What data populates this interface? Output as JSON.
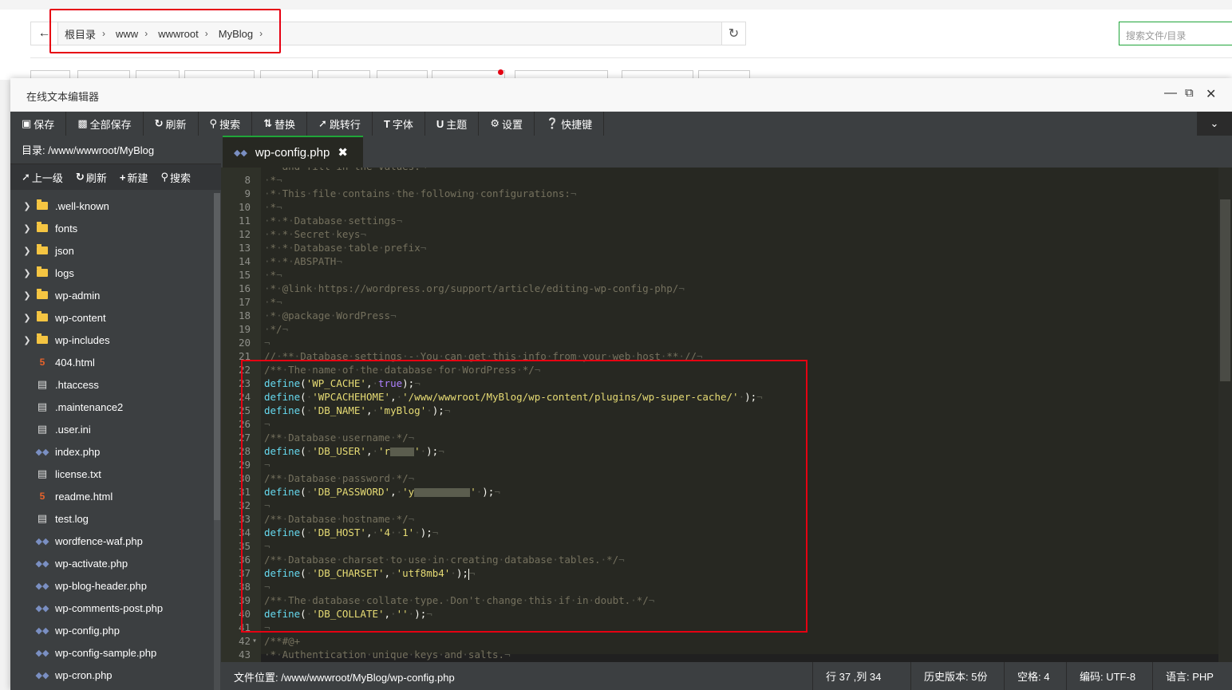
{
  "file_manager": {
    "breadcrumb": [
      "根目录",
      "www",
      "wwwroot",
      "MyBlog"
    ],
    "search_placeholder": "搜索文件/目录"
  },
  "editor": {
    "title": "在线文本编辑器",
    "toolbar": [
      {
        "icon": "save-icon",
        "label": "保存"
      },
      {
        "icon": "save-all-icon",
        "label": "全部保存"
      },
      {
        "icon": "refresh-icon",
        "label": "刷新"
      },
      {
        "icon": "search-icon",
        "label": "搜索"
      },
      {
        "icon": "replace-icon",
        "label": "替换"
      },
      {
        "icon": "pin-icon",
        "label": "跳转行"
      },
      {
        "icon": "font-icon",
        "label": "字体"
      },
      {
        "icon": "theme-icon",
        "label": "主题"
      },
      {
        "icon": "gear-icon",
        "label": "设置"
      },
      {
        "icon": "help-icon",
        "label": "快捷键"
      }
    ],
    "sidebar": {
      "dir_label": "目录: /www/wwwroot/MyBlog",
      "tools": {
        "up": "上一级",
        "refresh": "刷新",
        "new": "新建",
        "search": "搜索"
      },
      "files": [
        {
          "name": ".well-known",
          "type": "folder"
        },
        {
          "name": "fonts",
          "type": "folder"
        },
        {
          "name": "json",
          "type": "folder"
        },
        {
          "name": "logs",
          "type": "folder"
        },
        {
          "name": "wp-admin",
          "type": "folder"
        },
        {
          "name": "wp-content",
          "type": "folder"
        },
        {
          "name": "wp-includes",
          "type": "folder"
        },
        {
          "name": "404.html",
          "type": "html"
        },
        {
          "name": ".htaccess",
          "type": "text"
        },
        {
          "name": ".maintenance2",
          "type": "text"
        },
        {
          "name": ".user.ini",
          "type": "text"
        },
        {
          "name": "index.php",
          "type": "php"
        },
        {
          "name": "license.txt",
          "type": "text"
        },
        {
          "name": "readme.html",
          "type": "html"
        },
        {
          "name": "test.log",
          "type": "text"
        },
        {
          "name": "wordfence-waf.php",
          "type": "php"
        },
        {
          "name": "wp-activate.php",
          "type": "php"
        },
        {
          "name": "wp-blog-header.php",
          "type": "php"
        },
        {
          "name": "wp-comments-post.php",
          "type": "php"
        },
        {
          "name": "wp-config.php",
          "type": "php"
        },
        {
          "name": "wp-config-sample.php",
          "type": "php"
        },
        {
          "name": "wp-cron.php",
          "type": "php"
        }
      ]
    },
    "tab": {
      "filename": "wp-config.php"
    },
    "status": {
      "file_path": "文件位置: /www/wwwroot/MyBlog/wp-config.php",
      "cursor": "行 37 ,列 34",
      "history": "历史版本: 5份",
      "indent": "空格: 4",
      "encoding": "编码: UTF-8",
      "language": "语言: PHP"
    },
    "code_lines": [
      {
        "n": "",
        "text": " * and fill in the values."
      },
      {
        "n": "8",
        "text": " *"
      },
      {
        "n": "9",
        "text": " * This file contains the following configurations:"
      },
      {
        "n": "10",
        "text": " *"
      },
      {
        "n": "11",
        "text": " * * Database settings"
      },
      {
        "n": "12",
        "text": " * * Secret keys"
      },
      {
        "n": "13",
        "text": " * * Database table prefix"
      },
      {
        "n": "14",
        "text": " * * ABSPATH"
      },
      {
        "n": "15",
        "text": " *"
      },
      {
        "n": "16",
        "text": " * @link https://wordpress.org/support/article/editing-wp-config-php/"
      },
      {
        "n": "17",
        "text": " *"
      },
      {
        "n": "18",
        "text": " * @package WordPress"
      },
      {
        "n": "19",
        "text": " */"
      },
      {
        "n": "20",
        "text": ""
      },
      {
        "n": "21",
        "text": "// ** Database settings - You can get this info from your web host ** //"
      },
      {
        "n": "22",
        "text": "/** The name of the database for WordPress */"
      },
      {
        "n": "23",
        "text": "define('WP_CACHE', true);"
      },
      {
        "n": "24",
        "text": "define( 'WPCACHEHOME', '/www/wwwroot/MyBlog/wp-content/plugins/wp-super-cache/' );"
      },
      {
        "n": "25",
        "text": "define( 'DB_NAME', 'myBlog' );"
      },
      {
        "n": "26",
        "text": ""
      },
      {
        "n": "27",
        "text": "/** Database username */"
      },
      {
        "n": "28",
        "text": "define( 'DB_USER', 'r' );"
      },
      {
        "n": "29",
        "text": ""
      },
      {
        "n": "30",
        "text": "/** Database password */"
      },
      {
        "n": "31",
        "text": "define( 'DB_PASSWORD', 'y' );"
      },
      {
        "n": "32",
        "text": ""
      },
      {
        "n": "33",
        "text": "/** Database hostname */"
      },
      {
        "n": "34",
        "text": "define( 'DB_HOST', '4  1' );"
      },
      {
        "n": "35",
        "text": ""
      },
      {
        "n": "36",
        "text": "/** Database charset to use in creating database tables. */"
      },
      {
        "n": "37",
        "text": "define( 'DB_CHARSET', 'utf8mb4' );"
      },
      {
        "n": "38",
        "text": ""
      },
      {
        "n": "39",
        "text": "/** The database collate type. Don't change this if in doubt. */"
      },
      {
        "n": "40",
        "text": "define( 'DB_COLLATE', '' );"
      },
      {
        "n": "41",
        "text": ""
      },
      {
        "n": "42",
        "text": "/**#@+"
      },
      {
        "n": "43",
        "text": " * Authentication unique keys and salts."
      }
    ]
  }
}
